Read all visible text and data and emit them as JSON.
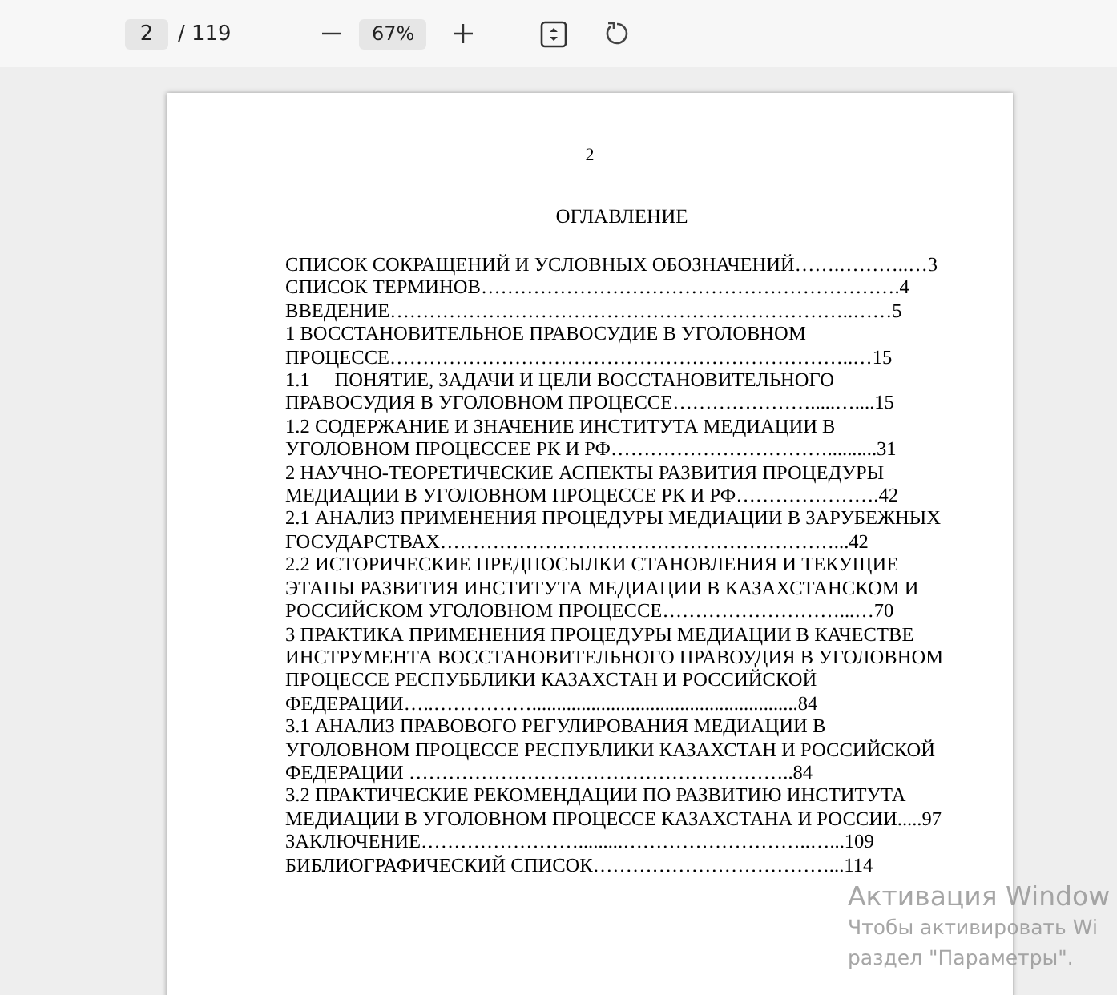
{
  "toolbar": {
    "page_input": "2",
    "page_total": "/ 119",
    "zoom": "67%"
  },
  "page": {
    "number": "2",
    "title": "ОГЛАВЛЕНИЕ",
    "toc": [
      {
        "lines": [
          "СПИСОК СОКРАЩЕНИЙ И УСЛОВНЫХ ОБОЗНАЧЕНИЙ…….………..…3"
        ]
      },
      {
        "lines": [
          "СПИСОК ТЕРМИНОВ……………………………………………………….4"
        ]
      },
      {
        "lines": [
          "ВВЕДЕНИЕ……………………………………………………………..……5"
        ]
      },
      {
        "lines": [
          "1 ВОССТАНОВИТЕЛЬНОЕ ПРАВОСУДИЕ В УГОЛОВНОМ",
          "ПРОЦЕССЕ……………………………………………………………..…15"
        ]
      },
      {
        "lines": [
          "1.1     ПОНЯТИЕ, ЗАДАЧИ И ЦЕЛИ ВОССТАНОВИТЕЛЬНОГО",
          "ПРАВОСУДИЯ В УГОЛОВНОМ ПРОЦЕССЕ………………….....…....15"
        ]
      },
      {
        "lines": [
          "1.2 СОДЕРЖАНИЕ И ЗНАЧЕНИЕ ИНСТИТУТА МЕДИАЦИИ В",
          "УГОЛОВНОМ ПРОЦЕССЕЕ РК И РФ……………………………..........31"
        ]
      },
      {
        "lines": [
          "2 НАУЧНО-ТЕОРЕТИЧЕСКИЕ АСПЕКТЫ РАЗВИТИЯ ПРОЦЕДУРЫ",
          "МЕДИАЦИИ В УГОЛОВНОМ ПРОЦЕССЕ РК И РФ………………….42"
        ]
      },
      {
        "lines": [
          "2.1 АНАЛИЗ ПРИМЕНЕНИЯ ПРОЦЕДУРЫ МЕДИАЦИИ В ЗАРУБЕЖНЫХ",
          "ГОСУДАРСТВАХ……………………………………………………...42"
        ]
      },
      {
        "lines": [
          "2.2 ИСТОРИЧЕСКИЕ ПРЕДПОСЫЛКИ СТАНОВЛЕНИЯ И ТЕКУЩИЕ",
          "ЭТАПЫ РАЗВИТИЯ ИНСТИТУТА МЕДИАЦИИ В КАЗАХСТАНСКОМ И",
          "РОССИЙСКОМ УГОЛОВНОМ ПРОЦЕССЕ………………………...…70"
        ]
      },
      {
        "lines": [
          "3 ПРАКТИКА ПРИМЕНЕНИЯ ПРОЦЕДУРЫ МЕДИАЦИИ В КАЧЕСТВЕ",
          "ИНСТРУМЕНТА ВОССТАНОВИТЕЛЬНОГО ПРАВОУДИЯ В УГОЛОВНОМ",
          "ПРОЦЕССЕ РЕСПУББЛИКИ КАЗАХСТАН И РОССИЙСКОЙ",
          "ФЕДЕРАЦИИ…..……………......................................................84"
        ]
      },
      {
        "lines": [
          "3.1 АНАЛИЗ ПРАВОВОГО РЕГУЛИРОВАНИЯ МЕДИАЦИИ В",
          "УГОЛОВНОМ ПРОЦЕССЕ РЕСПУБЛИКИ КАЗАХСТАН И РОССИЙСКОЙ",
          "ФЕДЕРАЦИИ …………………………………………………..84"
        ]
      },
      {
        "lines": [
          "3.2 ПРАКТИЧЕСКИЕ РЕКОМЕНДАЦИИ ПО РАЗВИТИЮ ИНСТИТУТА",
          "МЕДИАЦИИ В УГОЛОВНОМ ПРОЦЕССЕ КАЗАХСТАНА И РОССИИ.....97"
        ]
      },
      {
        "lines": [
          "ЗАКЛЮЧЕНИЕ…………………….........………………………..…...109"
        ]
      },
      {
        "lines": [
          "БИБЛИОГРАФИЧЕСКИЙ СПИСОК………………………………...114"
        ]
      }
    ]
  },
  "os_overlay": {
    "title": "Активация Window",
    "lines": [
      "Чтобы активировать Wi",
      "раздел \"Параметры\"."
    ]
  }
}
